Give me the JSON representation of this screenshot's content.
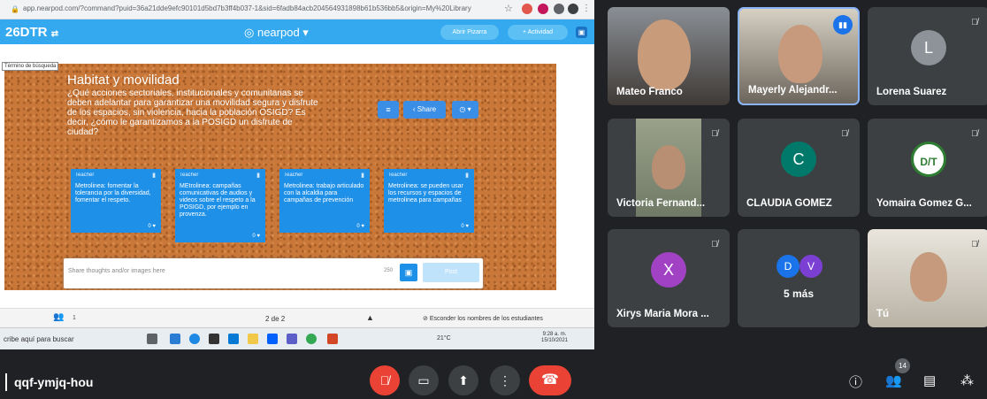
{
  "browser": {
    "url": "app.nearpod.com/?command?puid=36a21dde9efc90101d5bd7b3ff4b037-1&sid=6fadb84acb204564931898b61b536bb5&origin=My%20Library"
  },
  "nearpod": {
    "code": "26DTR",
    "code_icon": "⇄",
    "logo": "nearpod",
    "open_board_label": "Abrir Pizarra",
    "activity_label": "+ Actividad",
    "search_tooltip": "Término de búsqueda",
    "board_title": "Habitat y movilidad",
    "board_question": "¿Qué acciones sectoriales, institucionales y comunitarias se deben adelantar para garantizar una movilidad segura y disfrute de los espacios, sin violencia, hacia la población OSIGD? Es decir, ¿cómo le garantizamos a la POSIGD un disfrute de ciudad?",
    "share_label": "Share",
    "notes": [
      {
        "author": "Teacher",
        "text": "Metrolinea: fomentar la tolerancia por la diversidad, fomentar el respeto.",
        "likes": "0"
      },
      {
        "author": "Teacher",
        "text": "MEtrolinea: campañas comunicativas de audios y videos sobre el respeto a la POSIGD, por ejemplo en provenza.",
        "likes": "0"
      },
      {
        "author": "Teacher",
        "text": "Metrolinea: trabajo articulado con la alcaldia para campañas de prevención",
        "likes": "0"
      },
      {
        "author": "Teacher",
        "text": "Metrolinea: se pueden usar los recursos y espacios de metrolinea para campañas",
        "likes": "0"
      }
    ],
    "composer_placeholder": "Share thoughts and/or images here",
    "composer_count": "250",
    "post_label": "Post",
    "participants_count": "1",
    "page_indicator": "2 de 2",
    "hide_names_label": "Esconder los nombres de los estudiantes"
  },
  "taskbar": {
    "search": "cribe aquí para buscar",
    "weather": "21°C",
    "time": "9:28 a. m.",
    "date": "15/10/2021"
  },
  "meet": {
    "tiles": [
      {
        "name": "Mateo Franco",
        "type": "photo"
      },
      {
        "name": "Mayerly Alejandr...",
        "type": "photo",
        "speaking": true
      },
      {
        "name": "Lorena Suarez",
        "type": "avatar",
        "initial": "L",
        "color": "#8d9398",
        "muted": true
      },
      {
        "name": "Victoria Fernand...",
        "type": "photo",
        "muted": true
      },
      {
        "name": "CLAUDIA GOMEZ",
        "type": "avatar",
        "initial": "C",
        "color": "#00796b",
        "muted": true
      },
      {
        "name": "Yomaira Gomez G...",
        "type": "logo",
        "logo_text": "D/T",
        "muted": true
      },
      {
        "name": "Xirys Maria Mora ...",
        "type": "avatar",
        "initial": "X",
        "color": "#a142c4",
        "muted": true
      },
      {
        "name": "5 más",
        "type": "more",
        "initials": [
          "D",
          "V"
        ],
        "colors": [
          "#1a73e8",
          "#7b3fd4"
        ]
      },
      {
        "name": "Tú",
        "type": "photo",
        "muted": true
      }
    ],
    "meeting_code": "qqf-ymjq-hou",
    "participant_count": "14"
  }
}
